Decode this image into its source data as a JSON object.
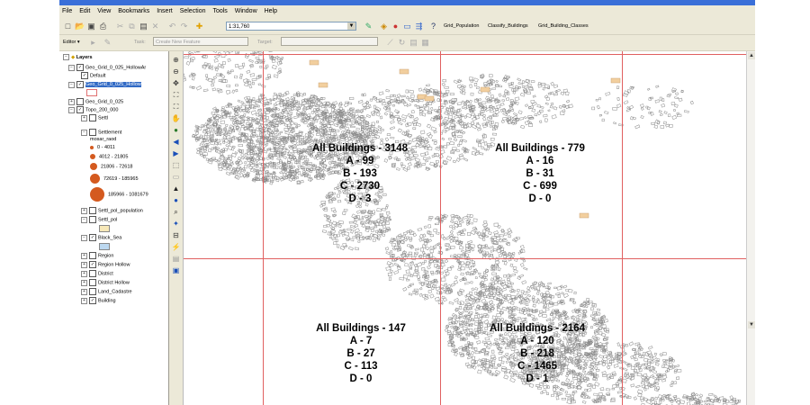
{
  "menu": [
    "File",
    "Edit",
    "View",
    "Bookmarks",
    "Insert",
    "Selection",
    "Tools",
    "Window",
    "Help"
  ],
  "toolbar": {
    "scale": "1:31,760",
    "custom_tools": [
      "Grid_Population",
      "Classify_Buildings",
      "Grid_Building_Classes"
    ],
    "editor_label": "Editor ▾",
    "task_label": "Task:",
    "task_value": "Create New Feature",
    "target_label": "Target:"
  },
  "toc": {
    "root": "Layers",
    "layers": [
      {
        "name": "Geo_Grid_0_025_HollowAr",
        "checked": true,
        "indent": 1
      },
      {
        "name": "Default",
        "checked": true,
        "indent": 2
      },
      {
        "name": "Geo_Grid_0_025_Hollow",
        "checked": true,
        "indent": 1,
        "selected": true
      },
      {
        "name": "Geo_Grid_0_025",
        "checked": false,
        "indent": 1
      },
      {
        "name": "Topo_200_000",
        "checked": true,
        "indent": 1
      },
      {
        "name": "Settl",
        "checked": false,
        "indent": 2
      },
      {
        "name": "Settlement",
        "checked": false,
        "indent": 2
      },
      {
        "name": "mosar_raod",
        "checked": null,
        "indent": 3
      }
    ],
    "classes": [
      {
        "label": "0 - 4011",
        "size": 4
      },
      {
        "label": "4012 - 21805",
        "size": 6
      },
      {
        "label": "21806 - 72618",
        "size": 8
      },
      {
        "label": "72619 - 185965",
        "size": 11
      },
      {
        "label": "185966 - 1081679",
        "size": 16
      }
    ],
    "layers2": [
      {
        "name": "Settl_pol_population",
        "checked": false
      },
      {
        "name": "Settl_pol",
        "checked": false
      },
      {
        "name": "Black_Sea",
        "checked": true
      },
      {
        "name": "Region",
        "checked": false
      },
      {
        "name": "Region Hollow",
        "checked": true
      },
      {
        "name": "District",
        "checked": false
      },
      {
        "name": "District Hollow",
        "checked": false
      },
      {
        "name": "Land_Cadastre",
        "checked": false
      },
      {
        "name": "Building",
        "checked": true
      }
    ],
    "colors": {
      "settl_pol": "#f7e8b8",
      "black_sea": "#bcd8f0"
    }
  },
  "map": {
    "cells": [
      {
        "title": "All Buildings - 3148",
        "lines": [
          "A - 99",
          "B - 193",
          "C - 2730",
          "D - 3"
        ]
      },
      {
        "title": "All Buildings - 779",
        "lines": [
          "A - 16",
          "B - 31",
          "C - 699",
          "D - 0"
        ]
      },
      {
        "title": "All Buildings - 147",
        "lines": [
          "A - 7",
          "B - 27",
          "C - 113",
          "D - 0"
        ]
      },
      {
        "title": "All Buildings - 2164",
        "lines": [
          "A - 120",
          "B - 218",
          "C - 1465",
          "D - 1"
        ]
      }
    ],
    "colors": {
      "grid_line": "#e06060",
      "building": "#8a8a8a",
      "highlight": "#f2cf9e"
    }
  }
}
